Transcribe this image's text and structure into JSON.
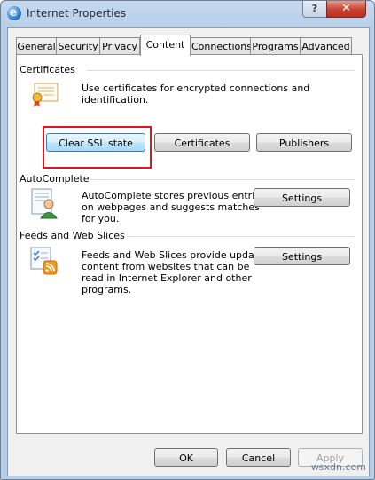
{
  "window": {
    "title": "Internet Properties",
    "help_label": "?",
    "close_label": "✕"
  },
  "tabs": [
    "General",
    "Security",
    "Privacy",
    "Content",
    "Connections",
    "Programs",
    "Advanced"
  ],
  "certificates": {
    "title": "Certificates",
    "description": "Use certificates for encrypted connections and identification.",
    "buttons": {
      "clear_ssl": "Clear SSL state",
      "certificates": "Certificates",
      "publishers": "Publishers"
    }
  },
  "autocomplete": {
    "title": "AutoComplete",
    "line1": "AutoComplete stores previous entries",
    "line2": "on webpages and suggests matches",
    "line3": "for you.",
    "settings": "Settings"
  },
  "feeds": {
    "title": "Feeds and Web Slices",
    "line1": "Feeds and Web Slices provide updated",
    "line2": "content from websites that can be",
    "line3": "read in Internet Explorer and other",
    "line4": "programs.",
    "settings": "Settings"
  },
  "footer": {
    "ok": "OK",
    "cancel": "Cancel",
    "apply": "Apply"
  },
  "watermark": "wsxdn.com",
  "colors": {
    "highlight": "#e0141e",
    "focus_border": "#3c7fb1"
  }
}
